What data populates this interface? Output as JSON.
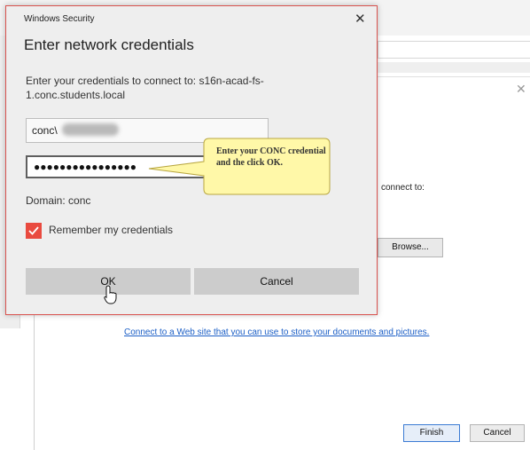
{
  "dialog": {
    "header": "Windows Security",
    "title": "Enter network credentials",
    "prompt": "Enter your credentials to connect to: s16n-acad-fs-1.conc.students.local",
    "username_value": "conc\\",
    "password_value": "●●●●●●●●●●●●●●●●",
    "domain": "Domain: conc",
    "remember_label": "Remember my credentials",
    "remember_checked": true,
    "ok_label": "OK",
    "cancel_label": "Cancel",
    "close_icon": "✕"
  },
  "callout": {
    "text": "Enter your CONC credential and the click OK."
  },
  "wizard": {
    "close_icon": "✕",
    "connect_text": "connect to:",
    "browse_label": "Browse...",
    "web_link": "Connect to a Web site that you can use to store your documents and pictures.",
    "finish_label": "Finish",
    "cancel_label": "Cancel"
  },
  "colors": {
    "dialog_border": "#d9534f",
    "checkbox": "#e94a3f",
    "callout_fill": "#fff8a8",
    "link": "#1c5fc6"
  }
}
